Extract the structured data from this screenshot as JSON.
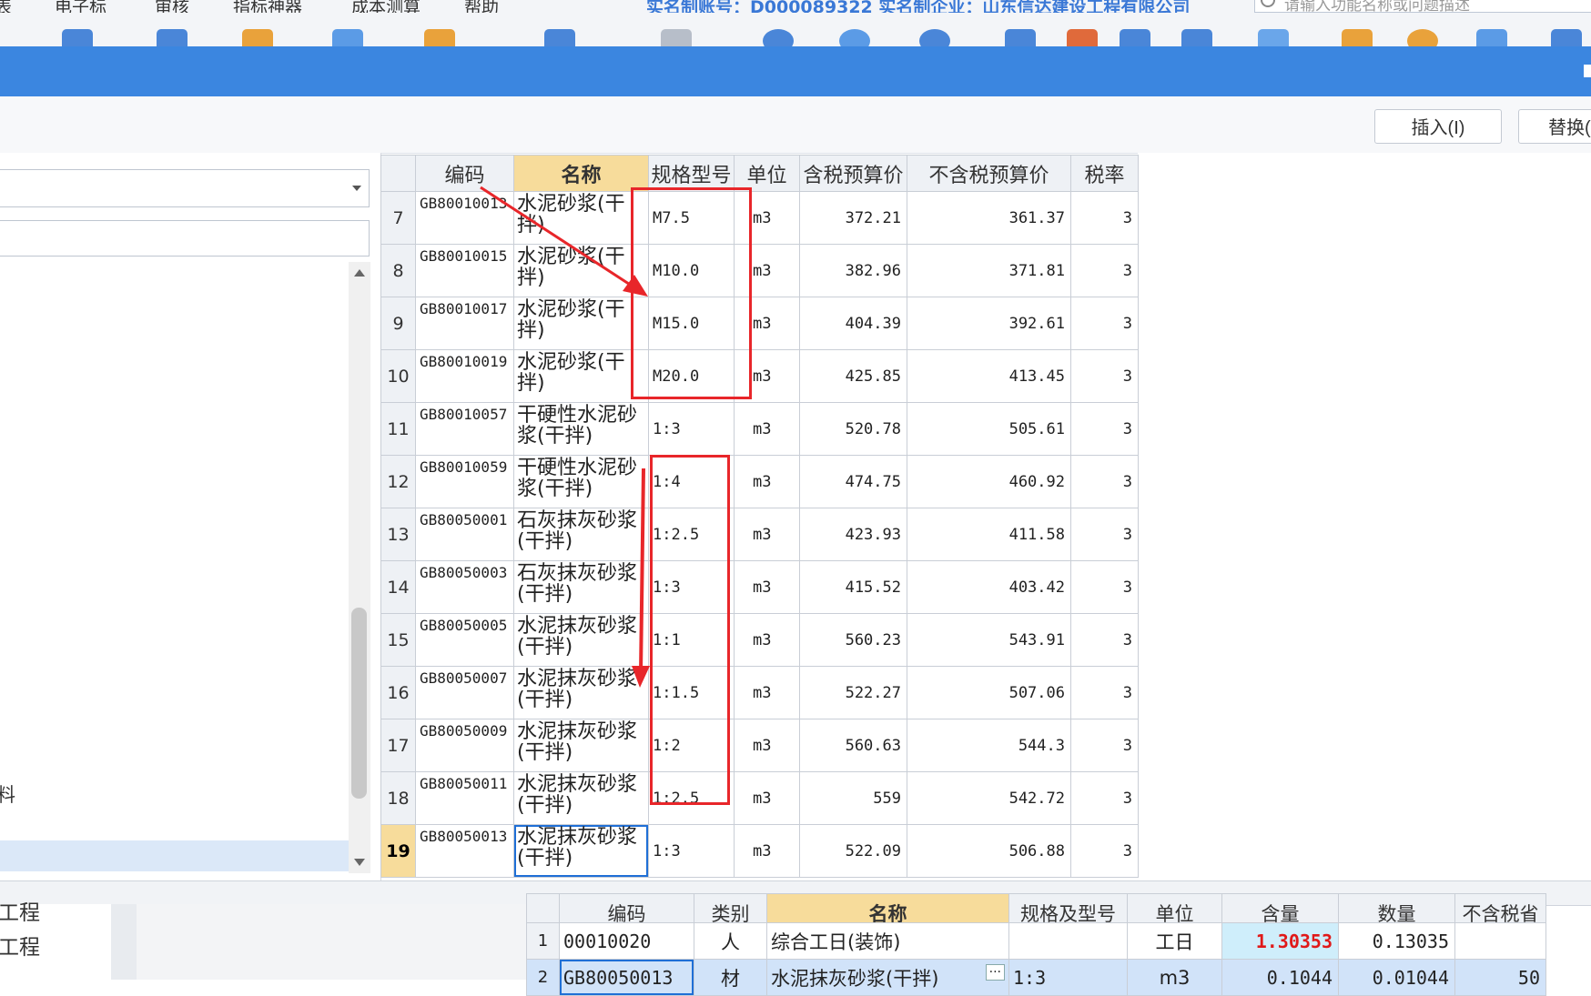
{
  "menu": {
    "items": [
      "表",
      "电子标",
      "审核",
      "指标神器",
      "成本测算",
      "帮助"
    ],
    "registration": "实名制账号：D000089322   实名制企业：山东信达建设工程有限公司",
    "search_placeholder": "请输入功能名称或问题描述"
  },
  "colors": {
    "title_bar": "#3b86e0",
    "header_highlight": "#f7dc9b",
    "annotation_red": "#e8262a",
    "selection": "#1f6fd6"
  },
  "actions": {
    "insert_label": "插入(I)",
    "replace_label": "替换("
  },
  "left_panel": {
    "tree_label": "料"
  },
  "material_table": {
    "headers": {
      "code": "编码",
      "name": "名称",
      "spec": "规格型号",
      "unit": "单位",
      "price_tax": "含税预算价",
      "price_notax": "不含税预算价",
      "tax_rate": "税率"
    },
    "rows": [
      {
        "no": "7",
        "code": "GB80010013",
        "name": "水泥砂浆(干拌)",
        "spec": "M7.5",
        "unit": "m3",
        "price_tax": "372.21",
        "price_notax": "361.37",
        "tax": "3"
      },
      {
        "no": "8",
        "code": "GB80010015",
        "name": "水泥砂浆(干拌)",
        "spec": "M10.0",
        "unit": "m3",
        "price_tax": "382.96",
        "price_notax": "371.81",
        "tax": "3"
      },
      {
        "no": "9",
        "code": "GB80010017",
        "name": "水泥砂浆(干拌)",
        "spec": "M15.0",
        "unit": "m3",
        "price_tax": "404.39",
        "price_notax": "392.61",
        "tax": "3"
      },
      {
        "no": "10",
        "code": "GB80010019",
        "name": "水泥砂浆(干拌)",
        "spec": "M20.0",
        "unit": "m3",
        "price_tax": "425.85",
        "price_notax": "413.45",
        "tax": "3"
      },
      {
        "no": "11",
        "code": "GB80010057",
        "name": "干硬性水泥砂浆(干拌)",
        "spec": "1:3",
        "unit": "m3",
        "price_tax": "520.78",
        "price_notax": "505.61",
        "tax": "3"
      },
      {
        "no": "12",
        "code": "GB80010059",
        "name": "干硬性水泥砂浆(干拌)",
        "spec": "1:4",
        "unit": "m3",
        "price_tax": "474.75",
        "price_notax": "460.92",
        "tax": "3"
      },
      {
        "no": "13",
        "code": "GB80050001",
        "name": "石灰抹灰砂浆(干拌)",
        "spec": "1:2.5",
        "unit": "m3",
        "price_tax": "423.93",
        "price_notax": "411.58",
        "tax": "3"
      },
      {
        "no": "14",
        "code": "GB80050003",
        "name": "石灰抹灰砂浆(干拌)",
        "spec": "1:3",
        "unit": "m3",
        "price_tax": "415.52",
        "price_notax": "403.42",
        "tax": "3"
      },
      {
        "no": "15",
        "code": "GB80050005",
        "name": "水泥抹灰砂浆(干拌)",
        "spec": "1:1",
        "unit": "m3",
        "price_tax": "560.23",
        "price_notax": "543.91",
        "tax": "3"
      },
      {
        "no": "16",
        "code": "GB80050007",
        "name": "水泥抹灰砂浆(干拌)",
        "spec": "1:1.5",
        "unit": "m3",
        "price_tax": "522.27",
        "price_notax": "507.06",
        "tax": "3"
      },
      {
        "no": "17",
        "code": "GB80050009",
        "name": "水泥抹灰砂浆(干拌)",
        "spec": "1:2",
        "unit": "m3",
        "price_tax": "560.63",
        "price_notax": "544.3",
        "tax": "3"
      },
      {
        "no": "18",
        "code": "GB80050011",
        "name": "水泥抹灰砂浆(干拌)",
        "spec": "1:2.5",
        "unit": "m3",
        "price_tax": "559",
        "price_notax": "542.72",
        "tax": "3"
      },
      {
        "no": "19",
        "code": "GB80050013",
        "name": "水泥抹灰砂浆(干拌)",
        "spec": "1:3",
        "unit": "m3",
        "price_tax": "522.09",
        "price_notax": "506.88",
        "tax": "3"
      }
    ],
    "current_row": "19"
  },
  "bottom_panel": {
    "left_labels": [
      "工程",
      "工程"
    ],
    "headers": {
      "code": "编码",
      "type": "类别",
      "name": "名称",
      "spec": "规格及型号",
      "unit": "单位",
      "content": "含量",
      "qty": "数量",
      "price_notax": "不含税省"
    },
    "rows": [
      {
        "no": "1",
        "code": "00010020",
        "type": "人",
        "name": "综合工日(装饰)",
        "spec": "",
        "unit": "工日",
        "content": "1.30353",
        "qty": "0.13035",
        "price": ""
      },
      {
        "no": "2",
        "code": "GB80050013",
        "type": "材",
        "name": "水泥抹灰砂浆(干拌)",
        "spec": "1:3",
        "unit": "m3",
        "content": "0.1044",
        "qty": "0.01044",
        "price": "50"
      }
    ],
    "ellipsis": "···"
  }
}
